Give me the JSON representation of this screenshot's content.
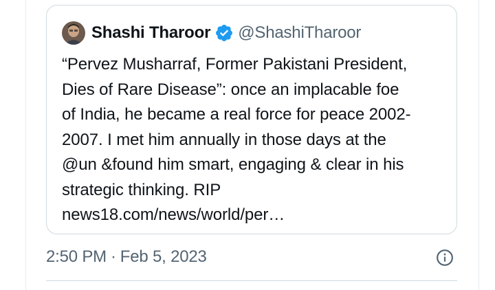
{
  "quoted_tweet": {
    "author": {
      "display_name": "Shashi Tharoor",
      "handle": "@ShashiTharoor",
      "verified_icon": "verified-badge-icon",
      "avatar": "avatar"
    },
    "text_lines": [
      "“Pervez Musharraf, Former Pakistani President,",
      "Dies of Rare Disease”: once an implacable foe",
      "of India, he became a real force for peace 2002-",
      "2007. I met him annually in those days at the",
      "@un &found him smart, engaging & clear in his",
      "strategic thinking. RIP",
      "news18.com/news/world/per…"
    ]
  },
  "meta": {
    "time": "2:50 PM",
    "separator": "·",
    "date": "Feb 5, 2023",
    "info_icon": "info-icon"
  },
  "colors": {
    "text_primary": "#0f1419",
    "text_secondary": "#536471",
    "verified_blue": "#1d9bf0",
    "border": "#cfd9de"
  }
}
